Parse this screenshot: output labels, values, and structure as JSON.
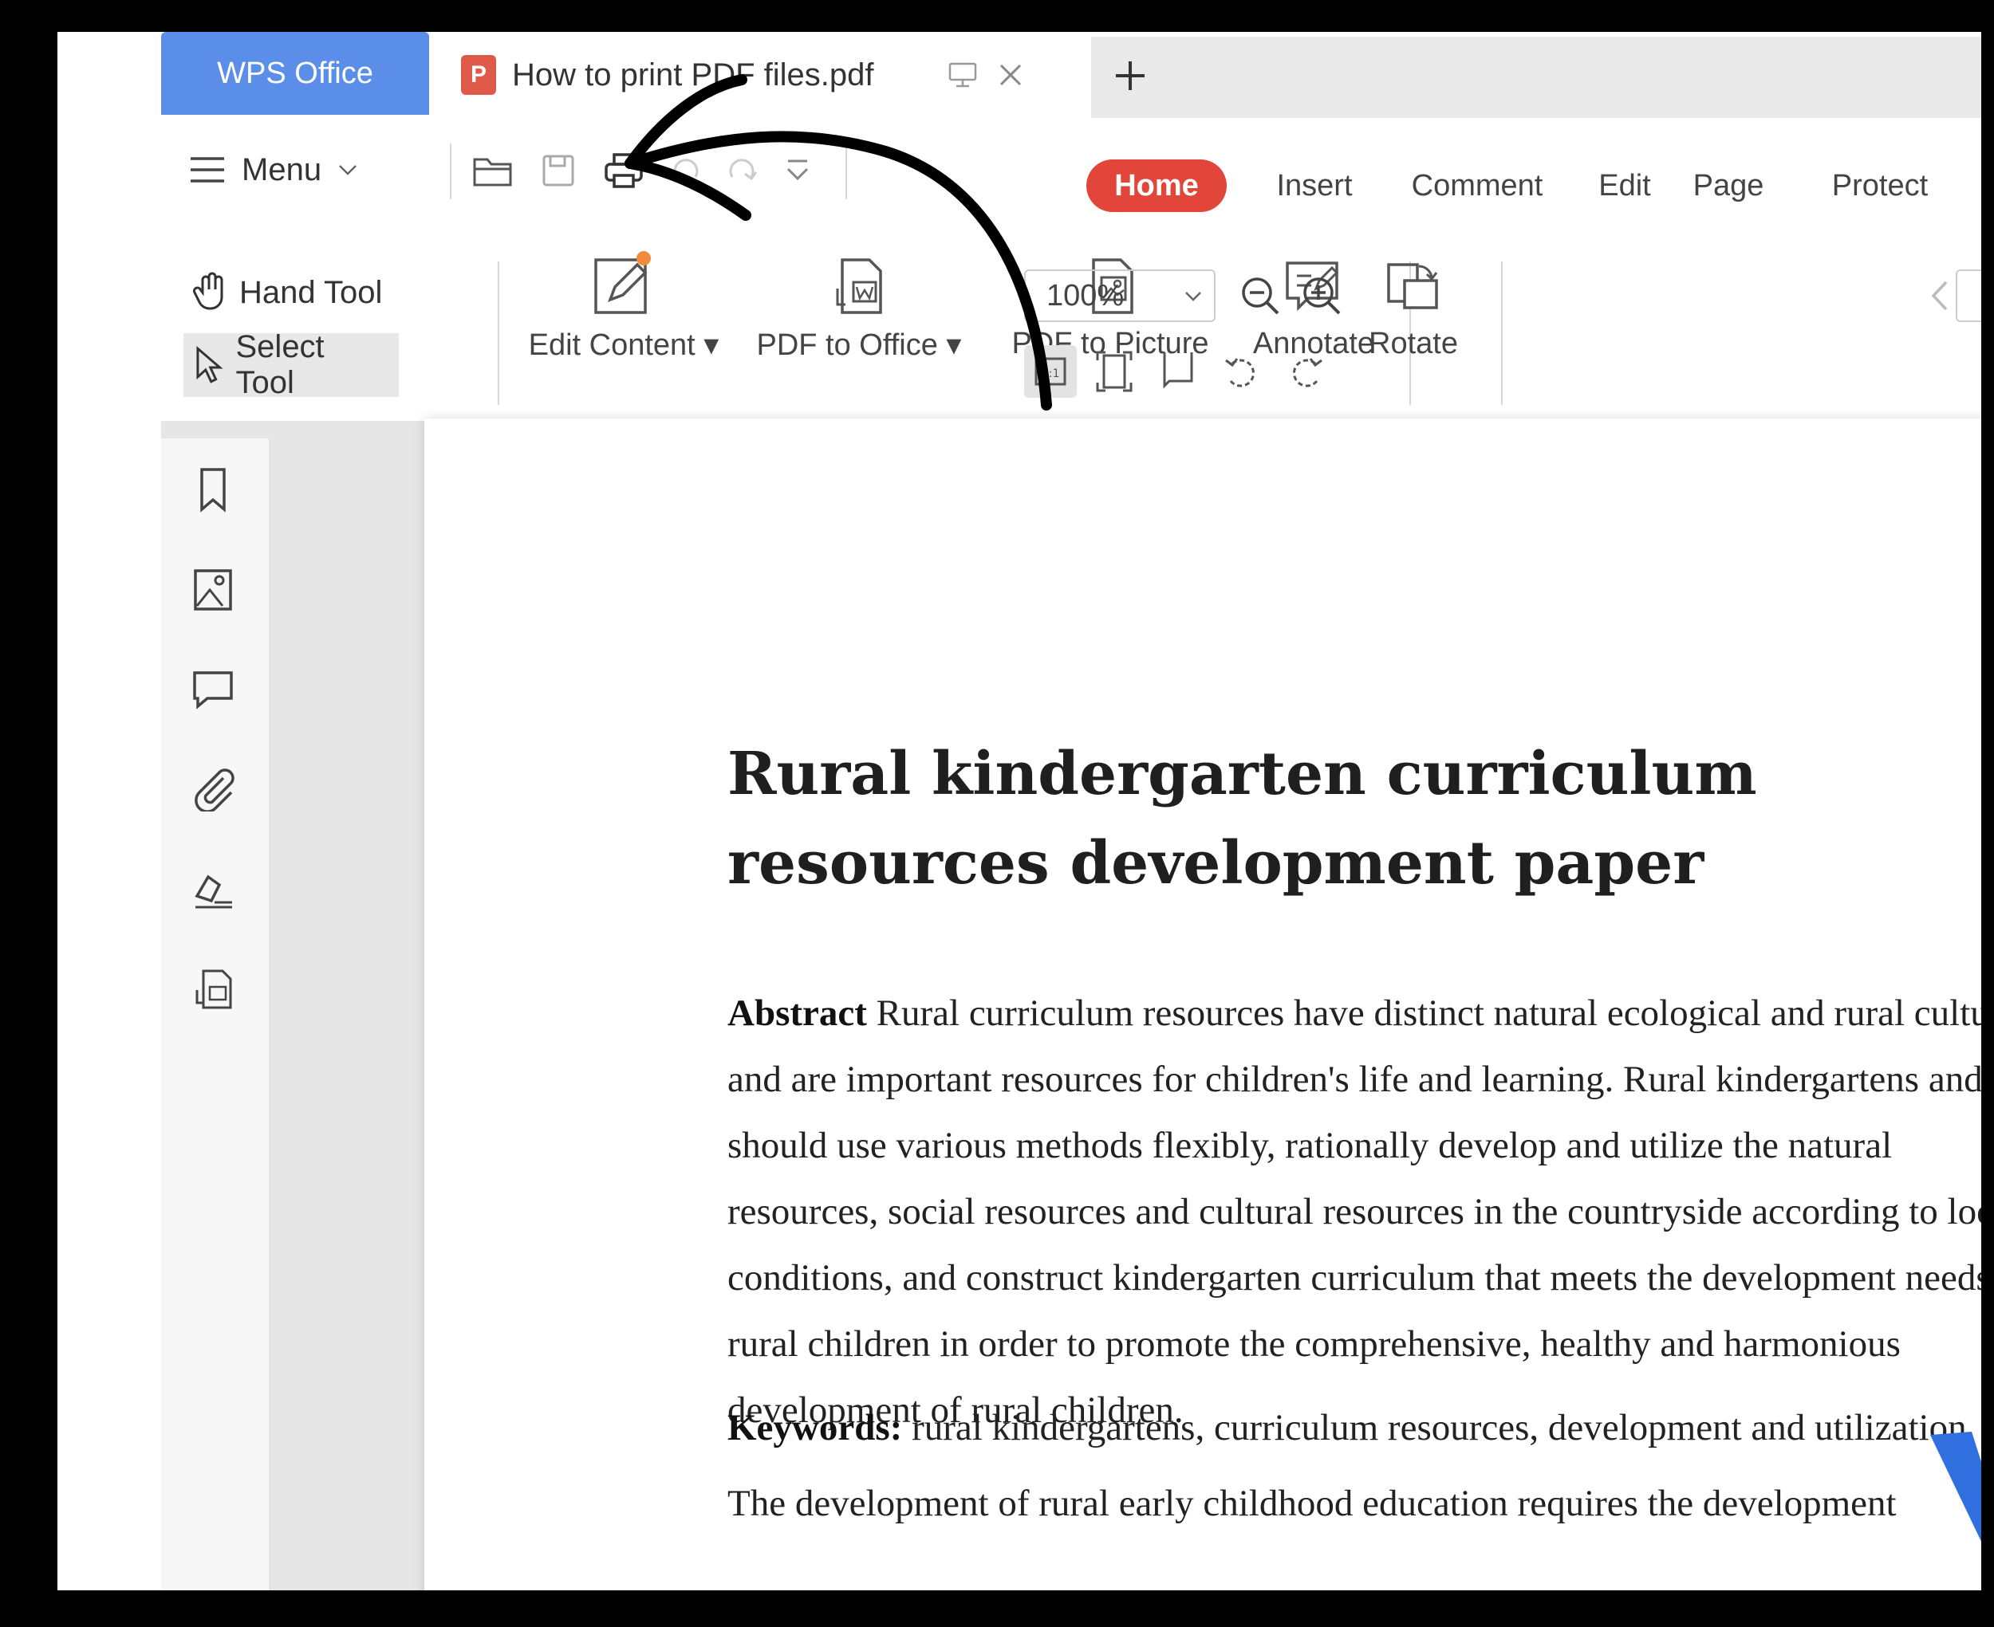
{
  "tabs": {
    "app_tab": "WPS Office",
    "doc_tab": "How to print PDF files.pdf",
    "pdf_glyph": "P"
  },
  "menu": {
    "label": "Menu",
    "ribbon_tabs": [
      "Home",
      "Insert",
      "Comment",
      "Edit",
      "Page",
      "Protect"
    ],
    "active_tab": "Home"
  },
  "tools": {
    "hand_tool": "Hand Tool",
    "select_tool": "Select Tool",
    "edit_content": "Edit Content",
    "pdf_to_office": "PDF to Office",
    "pdf_to_picture": "PDF to Picture",
    "annotate": "Annotate",
    "zoom_value": "100%",
    "rotate": "Rotate"
  },
  "document": {
    "title": "Rural kindergarten curriculum resources development paper",
    "abstract_label": "Abstract",
    "abstract_lines": [
      " Rural curriculum resources have distinct natural ecological and rural cultural characteristics",
      "and are important resources for children's life and learning. Rural kindergartens and teachers",
      "should use various methods flexibly, rationally develop and utilize the natural",
      "resources, social resources and cultural resources in the countryside according to local",
      "conditions, and construct kindergarten curriculum that meets the development needs of",
      "rural children in order to promote the comprehensive, healthy and harmonious",
      "development of rural children."
    ],
    "keywords_label": "Keywords:",
    "keywords": " rural kindergartens, curriculum resources, development and utilization",
    "body_first_line": "The development of rural early childhood education requires the development"
  },
  "colors": {
    "wps_tab": "#5b8ee8",
    "home_tab": "#e2463b",
    "annotation_arrow": "#000000",
    "logo_blue": "#2f6fe0"
  }
}
